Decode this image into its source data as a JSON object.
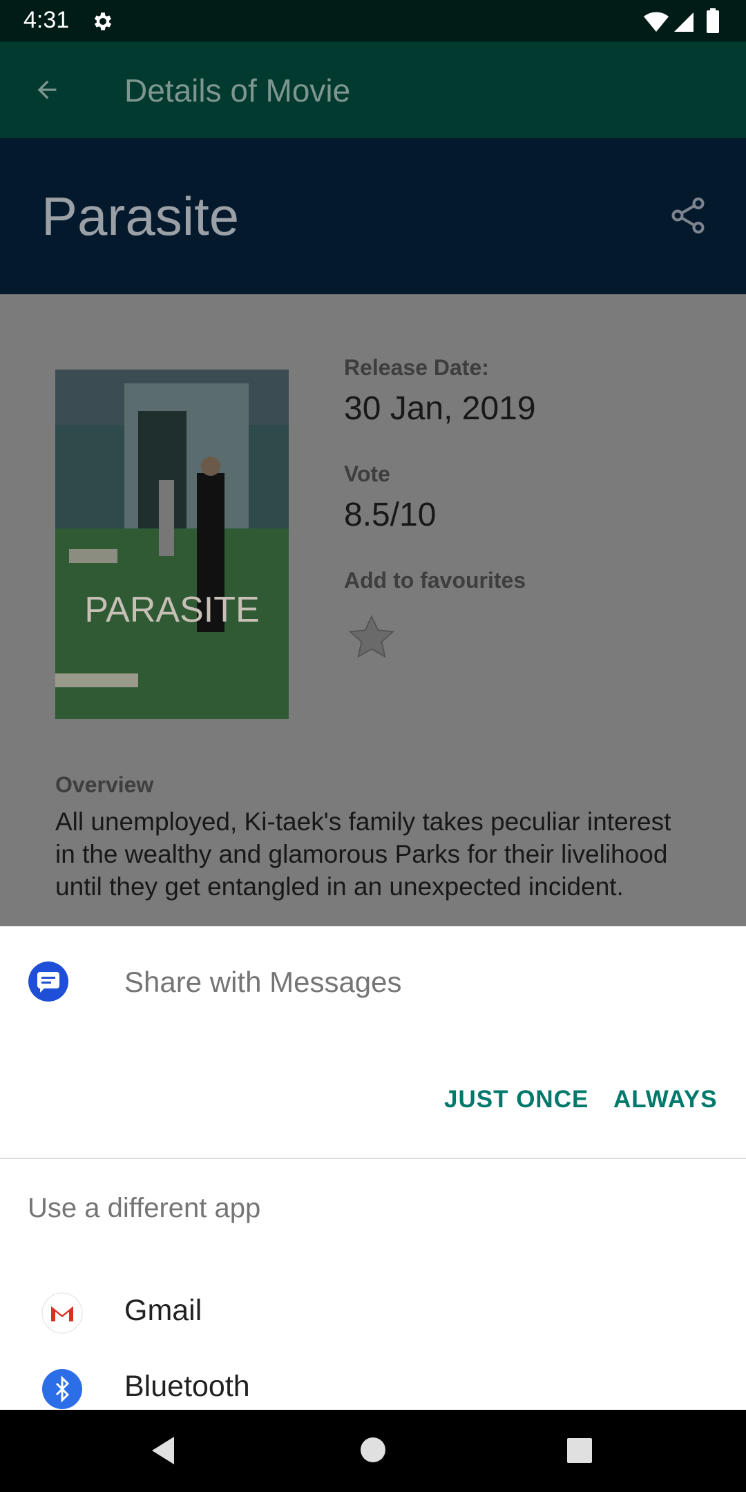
{
  "status_bar": {
    "time": "4:31"
  },
  "toolbar": {
    "title": "Details of Movie"
  },
  "header": {
    "movie_title": "Parasite"
  },
  "details": {
    "poster_text": "PARASITE",
    "release_label": "Release Date:",
    "release_value": "30 Jan, 2019",
    "vote_label": "Vote",
    "vote_value": "8.5/10",
    "fav_label": "Add to favourites",
    "overview_label": "Overview",
    "overview_text": "All unemployed, Ki-taek's family takes peculiar interest in the wealthy and glamorous Parks for their livelihood until they get entangled in an unexpected incident."
  },
  "share_sheet": {
    "title": "Share with Messages",
    "just_once": "JUST ONCE",
    "always": "ALWAYS",
    "different_app": "Use a different app",
    "apps": [
      {
        "label": "Gmail",
        "icon": "gmail-icon"
      },
      {
        "label": "Bluetooth",
        "icon": "bluetooth-icon"
      }
    ]
  },
  "colors": {
    "accent": "#00796b",
    "toolbar": "#033a30",
    "header": "#041a2c"
  }
}
